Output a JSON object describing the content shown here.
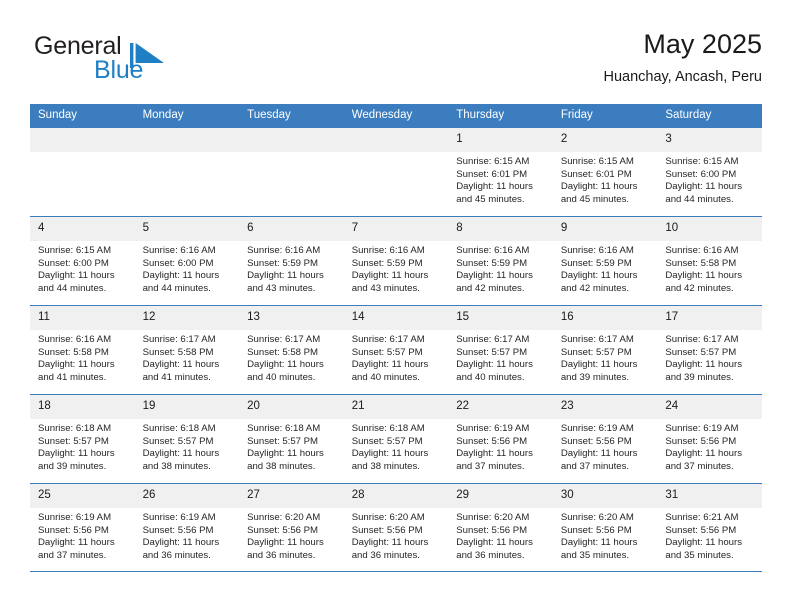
{
  "brand": {
    "name_part1": "General",
    "name_part2": "Blue",
    "logo_icon": "triangle-flag-icon",
    "colors": {
      "dark_text": "#231f20",
      "blue": "#1f7fc4",
      "header_blue": "#3b7dbf"
    }
  },
  "header": {
    "month_title": "May 2025",
    "location": "Huanchay, Ancash, Peru"
  },
  "calendar": {
    "weekday_headers": [
      "Sunday",
      "Monday",
      "Tuesday",
      "Wednesday",
      "Thursday",
      "Friday",
      "Saturday"
    ],
    "weeks": [
      [
        {
          "day": "",
          "empty": true,
          "sunrise": "",
          "sunset": "",
          "daylight_line1": "",
          "daylight_line2": ""
        },
        {
          "day": "",
          "empty": true,
          "sunrise": "",
          "sunset": "",
          "daylight_line1": "",
          "daylight_line2": ""
        },
        {
          "day": "",
          "empty": true,
          "sunrise": "",
          "sunset": "",
          "daylight_line1": "",
          "daylight_line2": ""
        },
        {
          "day": "",
          "empty": true,
          "sunrise": "",
          "sunset": "",
          "daylight_line1": "",
          "daylight_line2": ""
        },
        {
          "day": "1",
          "empty": false,
          "sunrise": "Sunrise: 6:15 AM",
          "sunset": "Sunset: 6:01 PM",
          "daylight_line1": "Daylight: 11 hours",
          "daylight_line2": "and 45 minutes."
        },
        {
          "day": "2",
          "empty": false,
          "sunrise": "Sunrise: 6:15 AM",
          "sunset": "Sunset: 6:01 PM",
          "daylight_line1": "Daylight: 11 hours",
          "daylight_line2": "and 45 minutes."
        },
        {
          "day": "3",
          "empty": false,
          "sunrise": "Sunrise: 6:15 AM",
          "sunset": "Sunset: 6:00 PM",
          "daylight_line1": "Daylight: 11 hours",
          "daylight_line2": "and 44 minutes."
        }
      ],
      [
        {
          "day": "4",
          "empty": false,
          "sunrise": "Sunrise: 6:15 AM",
          "sunset": "Sunset: 6:00 PM",
          "daylight_line1": "Daylight: 11 hours",
          "daylight_line2": "and 44 minutes."
        },
        {
          "day": "5",
          "empty": false,
          "sunrise": "Sunrise: 6:16 AM",
          "sunset": "Sunset: 6:00 PM",
          "daylight_line1": "Daylight: 11 hours",
          "daylight_line2": "and 44 minutes."
        },
        {
          "day": "6",
          "empty": false,
          "sunrise": "Sunrise: 6:16 AM",
          "sunset": "Sunset: 5:59 PM",
          "daylight_line1": "Daylight: 11 hours",
          "daylight_line2": "and 43 minutes."
        },
        {
          "day": "7",
          "empty": false,
          "sunrise": "Sunrise: 6:16 AM",
          "sunset": "Sunset: 5:59 PM",
          "daylight_line1": "Daylight: 11 hours",
          "daylight_line2": "and 43 minutes."
        },
        {
          "day": "8",
          "empty": false,
          "sunrise": "Sunrise: 6:16 AM",
          "sunset": "Sunset: 5:59 PM",
          "daylight_line1": "Daylight: 11 hours",
          "daylight_line2": "and 42 minutes."
        },
        {
          "day": "9",
          "empty": false,
          "sunrise": "Sunrise: 6:16 AM",
          "sunset": "Sunset: 5:59 PM",
          "daylight_line1": "Daylight: 11 hours",
          "daylight_line2": "and 42 minutes."
        },
        {
          "day": "10",
          "empty": false,
          "sunrise": "Sunrise: 6:16 AM",
          "sunset": "Sunset: 5:58 PM",
          "daylight_line1": "Daylight: 11 hours",
          "daylight_line2": "and 42 minutes."
        }
      ],
      [
        {
          "day": "11",
          "empty": false,
          "sunrise": "Sunrise: 6:16 AM",
          "sunset": "Sunset: 5:58 PM",
          "daylight_line1": "Daylight: 11 hours",
          "daylight_line2": "and 41 minutes."
        },
        {
          "day": "12",
          "empty": false,
          "sunrise": "Sunrise: 6:17 AM",
          "sunset": "Sunset: 5:58 PM",
          "daylight_line1": "Daylight: 11 hours",
          "daylight_line2": "and 41 minutes."
        },
        {
          "day": "13",
          "empty": false,
          "sunrise": "Sunrise: 6:17 AM",
          "sunset": "Sunset: 5:58 PM",
          "daylight_line1": "Daylight: 11 hours",
          "daylight_line2": "and 40 minutes."
        },
        {
          "day": "14",
          "empty": false,
          "sunrise": "Sunrise: 6:17 AM",
          "sunset": "Sunset: 5:57 PM",
          "daylight_line1": "Daylight: 11 hours",
          "daylight_line2": "and 40 minutes."
        },
        {
          "day": "15",
          "empty": false,
          "sunrise": "Sunrise: 6:17 AM",
          "sunset": "Sunset: 5:57 PM",
          "daylight_line1": "Daylight: 11 hours",
          "daylight_line2": "and 40 minutes."
        },
        {
          "day": "16",
          "empty": false,
          "sunrise": "Sunrise: 6:17 AM",
          "sunset": "Sunset: 5:57 PM",
          "daylight_line1": "Daylight: 11 hours",
          "daylight_line2": "and 39 minutes."
        },
        {
          "day": "17",
          "empty": false,
          "sunrise": "Sunrise: 6:17 AM",
          "sunset": "Sunset: 5:57 PM",
          "daylight_line1": "Daylight: 11 hours",
          "daylight_line2": "and 39 minutes."
        }
      ],
      [
        {
          "day": "18",
          "empty": false,
          "sunrise": "Sunrise: 6:18 AM",
          "sunset": "Sunset: 5:57 PM",
          "daylight_line1": "Daylight: 11 hours",
          "daylight_line2": "and 39 minutes."
        },
        {
          "day": "19",
          "empty": false,
          "sunrise": "Sunrise: 6:18 AM",
          "sunset": "Sunset: 5:57 PM",
          "daylight_line1": "Daylight: 11 hours",
          "daylight_line2": "and 38 minutes."
        },
        {
          "day": "20",
          "empty": false,
          "sunrise": "Sunrise: 6:18 AM",
          "sunset": "Sunset: 5:57 PM",
          "daylight_line1": "Daylight: 11 hours",
          "daylight_line2": "and 38 minutes."
        },
        {
          "day": "21",
          "empty": false,
          "sunrise": "Sunrise: 6:18 AM",
          "sunset": "Sunset: 5:57 PM",
          "daylight_line1": "Daylight: 11 hours",
          "daylight_line2": "and 38 minutes."
        },
        {
          "day": "22",
          "empty": false,
          "sunrise": "Sunrise: 6:19 AM",
          "sunset": "Sunset: 5:56 PM",
          "daylight_line1": "Daylight: 11 hours",
          "daylight_line2": "and 37 minutes."
        },
        {
          "day": "23",
          "empty": false,
          "sunrise": "Sunrise: 6:19 AM",
          "sunset": "Sunset: 5:56 PM",
          "daylight_line1": "Daylight: 11 hours",
          "daylight_line2": "and 37 minutes."
        },
        {
          "day": "24",
          "empty": false,
          "sunrise": "Sunrise: 6:19 AM",
          "sunset": "Sunset: 5:56 PM",
          "daylight_line1": "Daylight: 11 hours",
          "daylight_line2": "and 37 minutes."
        }
      ],
      [
        {
          "day": "25",
          "empty": false,
          "sunrise": "Sunrise: 6:19 AM",
          "sunset": "Sunset: 5:56 PM",
          "daylight_line1": "Daylight: 11 hours",
          "daylight_line2": "and 37 minutes."
        },
        {
          "day": "26",
          "empty": false,
          "sunrise": "Sunrise: 6:19 AM",
          "sunset": "Sunset: 5:56 PM",
          "daylight_line1": "Daylight: 11 hours",
          "daylight_line2": "and 36 minutes."
        },
        {
          "day": "27",
          "empty": false,
          "sunrise": "Sunrise: 6:20 AM",
          "sunset": "Sunset: 5:56 PM",
          "daylight_line1": "Daylight: 11 hours",
          "daylight_line2": "and 36 minutes."
        },
        {
          "day": "28",
          "empty": false,
          "sunrise": "Sunrise: 6:20 AM",
          "sunset": "Sunset: 5:56 PM",
          "daylight_line1": "Daylight: 11 hours",
          "daylight_line2": "and 36 minutes."
        },
        {
          "day": "29",
          "empty": false,
          "sunrise": "Sunrise: 6:20 AM",
          "sunset": "Sunset: 5:56 PM",
          "daylight_line1": "Daylight: 11 hours",
          "daylight_line2": "and 36 minutes."
        },
        {
          "day": "30",
          "empty": false,
          "sunrise": "Sunrise: 6:20 AM",
          "sunset": "Sunset: 5:56 PM",
          "daylight_line1": "Daylight: 11 hours",
          "daylight_line2": "and 35 minutes."
        },
        {
          "day": "31",
          "empty": false,
          "sunrise": "Sunrise: 6:21 AM",
          "sunset": "Sunset: 5:56 PM",
          "daylight_line1": "Daylight: 11 hours",
          "daylight_line2": "and 35 minutes."
        }
      ]
    ]
  }
}
